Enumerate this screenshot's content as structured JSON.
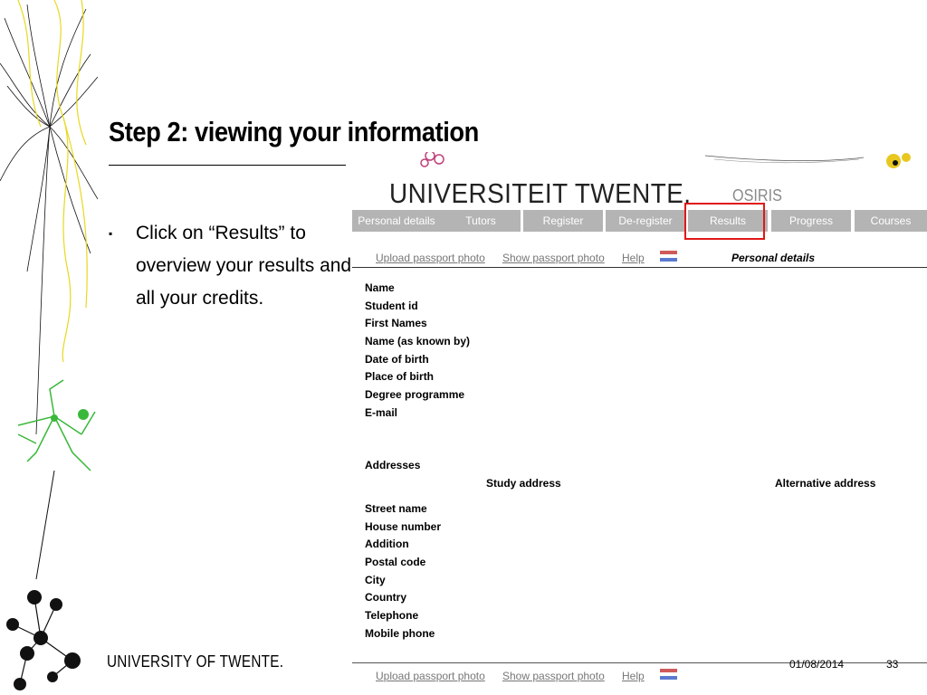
{
  "slide": {
    "title": "Step 2: viewing your information",
    "bullet": "Click on “Results” to overview your results and all your credits.",
    "bullet_marker": "▪",
    "footer_logo": "UNIVERSITY OF TWENTE.",
    "date": "01/08/2014",
    "page": "33"
  },
  "osiris": {
    "logo": "UNIVERSITEIT TWENTE.",
    "app_name": "OSIRIS",
    "tabs": [
      {
        "label": "Personal details"
      },
      {
        "label": "Tutors"
      },
      {
        "label": "Register"
      },
      {
        "label": "De-register"
      },
      {
        "label": "Results",
        "highlighted": true
      },
      {
        "label": "Progress"
      },
      {
        "label": "Courses"
      }
    ],
    "links": {
      "upload_photo": "Upload passport photo",
      "show_photo": "Show passport photo",
      "help": "Help"
    },
    "section_title": "Personal details",
    "personal_fields": [
      "Name",
      "Student id",
      "First Names",
      "Name (as known by)",
      "Date of birth",
      "Place of birth",
      "Degree programme",
      "E-mail"
    ],
    "addresses_label": "Addresses",
    "study_address_label": "Study address",
    "alternative_address_label": "Alternative address",
    "address_fields": [
      "Street name",
      "House number",
      "Addition",
      "Postal code",
      "City",
      "Country",
      "Telephone",
      "Mobile phone"
    ],
    "colors": {
      "tab_bg": "#b4b4b4",
      "highlight": "#e01818"
    }
  }
}
